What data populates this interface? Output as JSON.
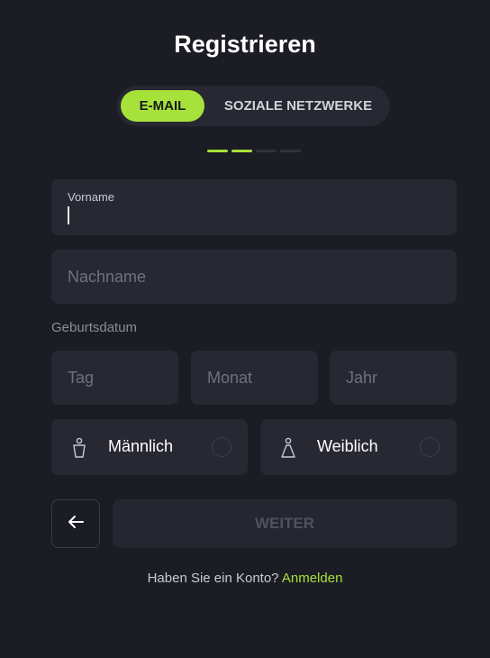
{
  "page": {
    "title": "Registrieren"
  },
  "tabs": {
    "email_label": "E-MAIL",
    "social_label": "SOZIALE NETZWERKE",
    "active": "E-MAIL"
  },
  "progress": {
    "total_steps": 4,
    "completed_steps": 2
  },
  "form": {
    "first_name": {
      "label": "Vorname",
      "value": ""
    },
    "last_name": {
      "placeholder": "Nachname",
      "value": ""
    },
    "birthdate": {
      "section_label": "Geburtsdatum",
      "day_placeholder": "Tag",
      "month_placeholder": "Monat",
      "year_placeholder": "Jahr"
    },
    "gender": {
      "male_label": "Männlich",
      "female_label": "Weiblich",
      "selected": null
    }
  },
  "actions": {
    "next_label": "WEITER"
  },
  "footer": {
    "prompt": "Haben Sie ein Konto?",
    "link_label": "Anmelden"
  },
  "colors": {
    "background": "#1c1d24",
    "surface": "#272832",
    "accent": "#a7e23a",
    "muted_text": "#6f717c"
  },
  "icons": {
    "back": "arrow-left-icon",
    "male": "male-person-icon",
    "female": "female-person-icon"
  }
}
